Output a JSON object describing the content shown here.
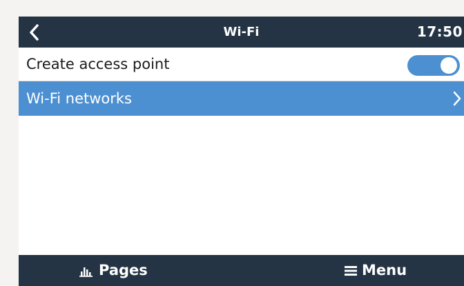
{
  "header": {
    "title": "Wi-Fi",
    "clock": "17:50",
    "back_icon": "chevron-left-icon"
  },
  "list": [
    {
      "label": "Create access point",
      "control": "toggle",
      "toggle_on": true
    },
    {
      "label": "Wi-Fi networks",
      "control": "chevron-right-icon",
      "selected": true
    }
  ],
  "footer": {
    "pages_label": "Pages",
    "pages_icon": "bar-chart-icon",
    "menu_label": "Menu",
    "menu_icon": "hamburger-icon"
  },
  "colors": {
    "bar_background": "#243444",
    "accent": "#4c90d2",
    "panel": "#ffffff",
    "backdrop": "#f4f3f1"
  }
}
